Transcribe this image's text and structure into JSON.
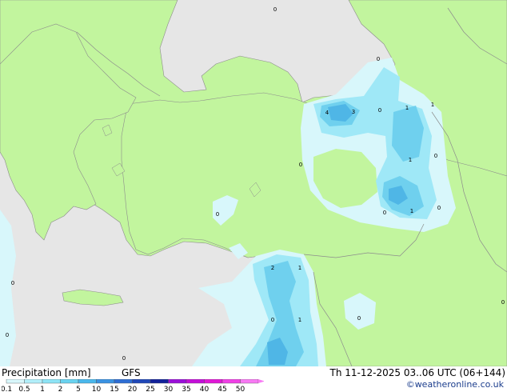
{
  "footer": {
    "title": "Precipitation [mm]",
    "model": "GFS",
    "datetime": "Th 11-12-2025 03..06 UTC (06+144)",
    "credit": "©weatheronline.co.uk"
  },
  "legend": {
    "ticks": [
      "0.1",
      "0.5",
      "1",
      "2",
      "5",
      "10",
      "15",
      "20",
      "25",
      "30",
      "35",
      "40",
      "45",
      "50"
    ],
    "colors": [
      "#d8f7fb",
      "#b2effa",
      "#8ee4f6",
      "#6ad3f0",
      "#4ab8ec",
      "#3a92e2",
      "#2e6ed4",
      "#2048b8",
      "#12229a",
      "#9a10d8",
      "#c40fd8",
      "#e018d6",
      "#f040e6",
      "#f87af4"
    ]
  },
  "colors": {
    "sea": "#e6e6e6",
    "land": "#c2f59e",
    "border": "#8c8c8c",
    "precip_light": "#d8f7fb",
    "precip_mid": "#9fe8f7",
    "precip_strong": "#6fd0ee",
    "precip_heavy": "#4fb6e6"
  },
  "map_labels": [
    {
      "text": "0"
    },
    {
      "text": "0"
    },
    {
      "text": "4"
    },
    {
      "text": "3"
    },
    {
      "text": "0"
    },
    {
      "text": "1"
    },
    {
      "text": "1"
    },
    {
      "text": "0"
    },
    {
      "text": "1"
    },
    {
      "text": "0"
    },
    {
      "text": "0"
    },
    {
      "text": "1"
    },
    {
      "text": "0"
    },
    {
      "text": "0"
    },
    {
      "text": "2"
    },
    {
      "text": "1"
    },
    {
      "text": "0"
    },
    {
      "text": "1"
    },
    {
      "text": "0"
    },
    {
      "text": "0"
    },
    {
      "text": "0"
    },
    {
      "text": "0"
    },
    {
      "text": "0"
    }
  ]
}
